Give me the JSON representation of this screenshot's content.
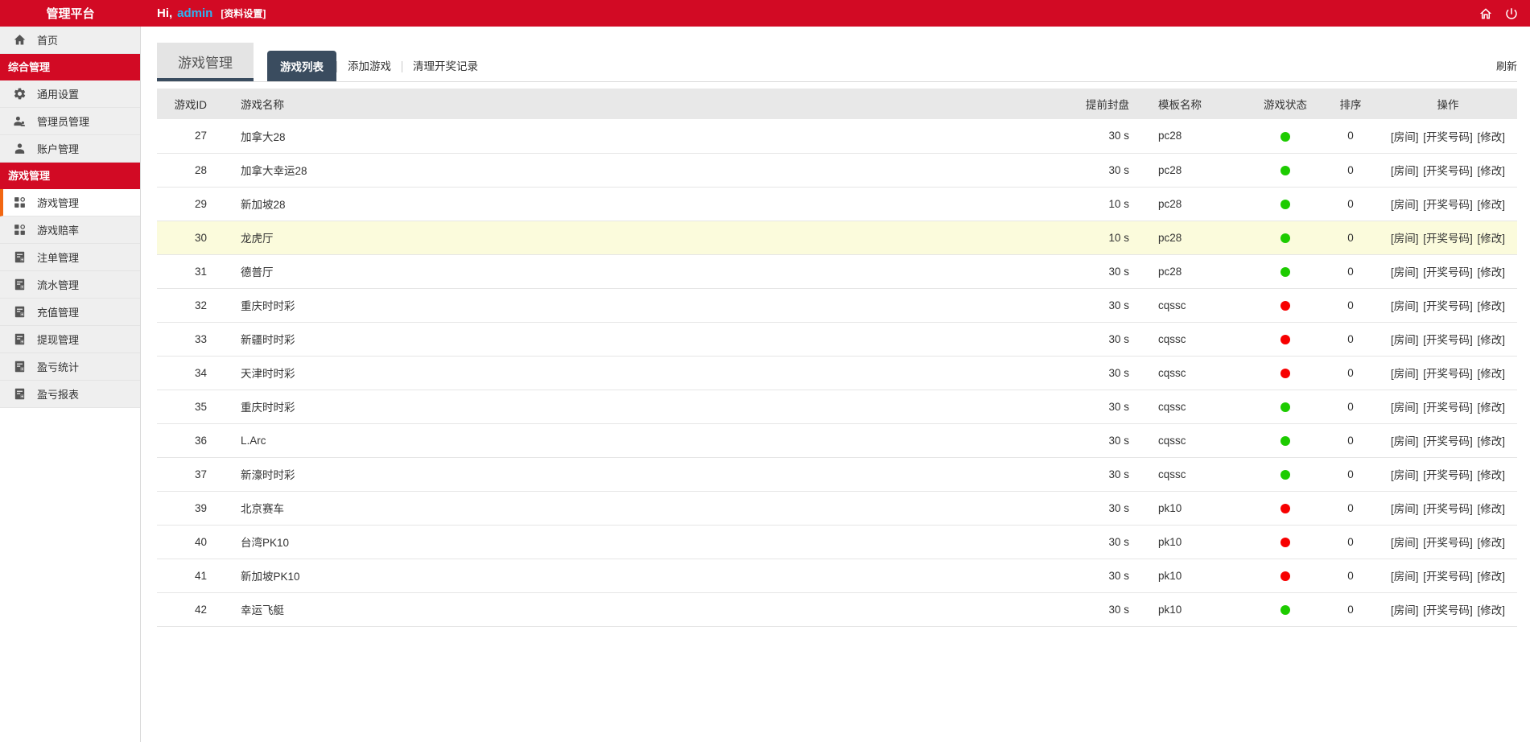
{
  "header": {
    "brand": "管理平台",
    "greeting_prefix": "Hi,",
    "username": "admin",
    "profile_link": "[资料设置]",
    "icons": [
      "home-icon",
      "power-icon"
    ]
  },
  "colors": {
    "brand_red": "#d20a24",
    "username_blue": "#2db3f2",
    "active_tab_navy": "#3a4c5f",
    "active_item_orange": "#f26712",
    "row_highlight_yellow": "#fbfbdc",
    "status_green": "#1dcb00",
    "status_red": "#f70000"
  },
  "sidebar": {
    "items": [
      {
        "type": "item",
        "icon": "home-icon",
        "label": "首页",
        "active": false
      },
      {
        "type": "section",
        "label": "综合管理"
      },
      {
        "type": "item",
        "icon": "gear-icon",
        "label": "通用设置",
        "active": false
      },
      {
        "type": "item",
        "icon": "users-icon",
        "label": "管理员管理",
        "active": false
      },
      {
        "type": "item",
        "icon": "user-icon",
        "label": "账户管理",
        "active": false
      },
      {
        "type": "section",
        "label": "游戏管理"
      },
      {
        "type": "item",
        "icon": "grid-icon",
        "label": "游戏管理",
        "active": true
      },
      {
        "type": "item",
        "icon": "grid-icon",
        "label": "游戏赔率",
        "active": false
      },
      {
        "type": "item",
        "icon": "report-icon",
        "label": "注单管理",
        "active": false
      },
      {
        "type": "item",
        "icon": "report-icon",
        "label": "流水管理",
        "active": false
      },
      {
        "type": "item",
        "icon": "report-icon",
        "label": "充值管理",
        "active": false
      },
      {
        "type": "item",
        "icon": "report-icon",
        "label": "提现管理",
        "active": false
      },
      {
        "type": "item",
        "icon": "report-icon",
        "label": "盈亏统计",
        "active": false
      },
      {
        "type": "item",
        "icon": "report-icon",
        "label": "盈亏报表",
        "active": false
      }
    ]
  },
  "main": {
    "page_title": "游戏管理",
    "tabs": [
      {
        "label": "游戏列表",
        "active": true
      },
      {
        "label": "添加游戏",
        "active": false
      },
      {
        "label": "清理开奖记录",
        "active": false
      }
    ],
    "refresh_label": "刷新",
    "table": {
      "columns": [
        "游戏ID",
        "游戏名称",
        "提前封盘",
        "模板名称",
        "游戏状态",
        "排序",
        "操作"
      ],
      "action_labels": [
        "[房间]",
        "[开奖号码]",
        "[修改]"
      ],
      "rows": [
        {
          "id": 27,
          "name": "加拿大28",
          "close": "30 s",
          "template": "pc28",
          "status": "green",
          "sort": 0,
          "highlight": false
        },
        {
          "id": 28,
          "name": "加拿大幸运28",
          "close": "30 s",
          "template": "pc28",
          "status": "green",
          "sort": 0,
          "highlight": false
        },
        {
          "id": 29,
          "name": "新加坡28",
          "close": "10 s",
          "template": "pc28",
          "status": "green",
          "sort": 0,
          "highlight": false
        },
        {
          "id": 30,
          "name": "龙虎厅",
          "close": "10 s",
          "template": "pc28",
          "status": "green",
          "sort": 0,
          "highlight": true
        },
        {
          "id": 31,
          "name": "德普厅",
          "close": "30 s",
          "template": "pc28",
          "status": "green",
          "sort": 0,
          "highlight": false
        },
        {
          "id": 32,
          "name": "重庆时时彩",
          "close": "30 s",
          "template": "cqssc",
          "status": "red",
          "sort": 0,
          "highlight": false
        },
        {
          "id": 33,
          "name": "新疆时时彩",
          "close": "30 s",
          "template": "cqssc",
          "status": "red",
          "sort": 0,
          "highlight": false
        },
        {
          "id": 34,
          "name": "天津时时彩",
          "close": "30 s",
          "template": "cqssc",
          "status": "red",
          "sort": 0,
          "highlight": false
        },
        {
          "id": 35,
          "name": "重庆时时彩",
          "close": "30 s",
          "template": "cqssc",
          "status": "green",
          "sort": 0,
          "highlight": false
        },
        {
          "id": 36,
          "name": "L.Arc",
          "close": "30 s",
          "template": "cqssc",
          "status": "green",
          "sort": 0,
          "highlight": false
        },
        {
          "id": 37,
          "name": "新濠时时彩",
          "close": "30 s",
          "template": "cqssc",
          "status": "green",
          "sort": 0,
          "highlight": false
        },
        {
          "id": 39,
          "name": "北京赛车",
          "close": "30 s",
          "template": "pk10",
          "status": "red",
          "sort": 0,
          "highlight": false
        },
        {
          "id": 40,
          "name": "台湾PK10",
          "close": "30 s",
          "template": "pk10",
          "status": "red",
          "sort": 0,
          "highlight": false
        },
        {
          "id": 41,
          "name": "新加坡PK10",
          "close": "30 s",
          "template": "pk10",
          "status": "red",
          "sort": 0,
          "highlight": false
        },
        {
          "id": 42,
          "name": "幸运飞艇",
          "close": "30 s",
          "template": "pk10",
          "status": "green",
          "sort": 0,
          "highlight": false
        }
      ]
    }
  }
}
